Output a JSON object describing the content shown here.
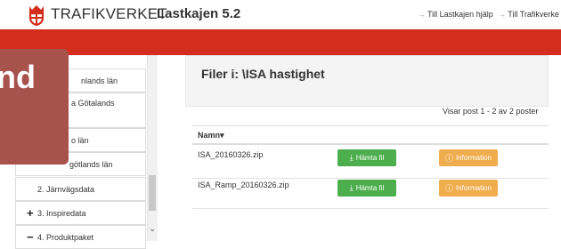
{
  "header": {
    "logo_text": "TRAFIKVERKET",
    "app_title": "Lastkajen 5.2",
    "links": [
      "Till Lastkajen hjälp",
      "Till Trafikverke"
    ]
  },
  "overlay": {
    "text": "nd"
  },
  "sidebar": {
    "items": [
      {
        "label": "nlands län"
      },
      {
        "label": "a Götalands"
      },
      {
        "label": "o län"
      },
      {
        "label": "götlands län"
      },
      {
        "label": "2. Järnvägsdata"
      },
      {
        "label": "3. Inspiredata",
        "symbol": "+"
      },
      {
        "label": "4. Produktpaket",
        "symbol": "−"
      }
    ]
  },
  "main": {
    "title": "Filer i: \\ISA hastighet",
    "count_text": "Visar post 1 - 2 av 2 poster",
    "column_name": "Namn",
    "download_label": "Hämta fil",
    "info_label": "Information",
    "files": [
      {
        "name": "ISA_20160326.zip"
      },
      {
        "name": "ISA_Ramp_20160326.zip"
      }
    ]
  },
  "colors": {
    "brand_red": "#d42d1e",
    "download_green": "#4cae4c",
    "info_orange": "#f0ad4e"
  }
}
